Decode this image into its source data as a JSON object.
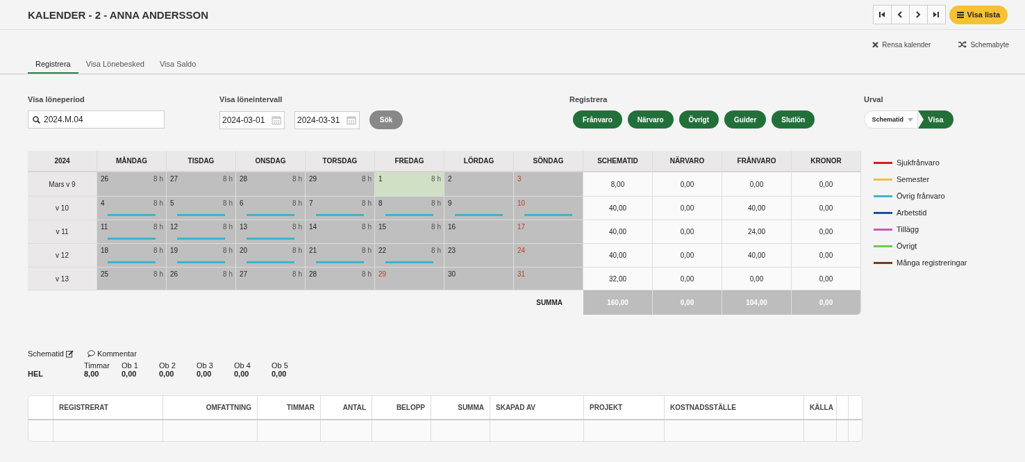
{
  "header": {
    "title": "KALENDER - 2 - ANNA ANDERSSON",
    "list_button": "Visa lista"
  },
  "actions": [
    {
      "kind": "clear",
      "label": "Rensa kalender"
    },
    {
      "kind": "shuffle",
      "label": "Schemabyte"
    }
  ],
  "tabs": [
    {
      "label": "Registrera",
      "selected": true
    },
    {
      "label": "Visa Lönebesked",
      "selected": false
    },
    {
      "label": "Visa Saldo",
      "selected": false
    }
  ],
  "filters": {
    "period_label": "Visa löneperiod",
    "period_value": "2024.M.04",
    "interval_label": "Visa löneintervall",
    "from": "2024-03-01",
    "to": "2024-03-31",
    "search_button": "Sök",
    "register_label": "Registrera",
    "register_buttons": [
      "Frånvaro",
      "Närvaro",
      "Övrigt",
      "Guider",
      "Slutlön"
    ],
    "selection_label": "Urval",
    "selection_value": "Schematid",
    "show_button": "Visa"
  },
  "calendar": {
    "year": "2024",
    "day_columns": [
      "MÅNDAG",
      "TISDAG",
      "ONSDAG",
      "TORSDAG",
      "FREDAG",
      "LÖRDAG",
      "SÖNDAG"
    ],
    "sum_columns": [
      "SCHEMATID",
      "NÄRVARO",
      "FRÅNVARO",
      "KRONOR"
    ],
    "weeks": [
      {
        "label": "Mars v 9",
        "sums": [
          "8,00",
          "0,00",
          "0,00",
          "0,00"
        ],
        "days": [
          {
            "day": "26",
            "hours": "8 h",
            "holiday": false,
            "selected": false
          },
          {
            "day": "27",
            "hours": "8 h",
            "holiday": false,
            "selected": false
          },
          {
            "day": "28",
            "hours": "8 h",
            "holiday": false,
            "selected": false
          },
          {
            "day": "29",
            "hours": "8 h",
            "holiday": false,
            "selected": false
          },
          {
            "day": "1",
            "hours": "8 h",
            "holiday": false,
            "selected": true
          },
          {
            "day": "2",
            "holiday": false,
            "selected": false
          },
          {
            "day": "3",
            "holiday": true,
            "selected": false
          }
        ]
      },
      {
        "label": "v 10",
        "sums": [
          "40,00",
          "0,00",
          "40,00",
          "0,00"
        ],
        "days": [
          {
            "day": "4",
            "hours": "8 h",
            "holiday": false,
            "selected": false,
            "color": "#3ab5cc"
          },
          {
            "day": "5",
            "hours": "8 h",
            "holiday": false,
            "selected": false,
            "color": "#3ab5cc"
          },
          {
            "day": "6",
            "hours": "8 h",
            "holiday": false,
            "selected": false,
            "color": "#3ab5cc"
          },
          {
            "day": "7",
            "hours": "8 h",
            "holiday": false,
            "selected": false,
            "color": "#3ab5cc"
          },
          {
            "day": "8",
            "hours": "8 h",
            "holiday": false,
            "selected": false,
            "color": "#3ab5cc"
          },
          {
            "day": "9",
            "holiday": false,
            "selected": false,
            "color": "#3ab5cc"
          },
          {
            "day": "10",
            "holiday": true,
            "selected": false,
            "color": "#3ab5cc"
          }
        ]
      },
      {
        "label": "v 11",
        "sums": [
          "40,00",
          "0,00",
          "24,00",
          "0,00"
        ],
        "days": [
          {
            "day": "11",
            "hours": "8 h",
            "holiday": false,
            "selected": false,
            "color": "#3ab5cc"
          },
          {
            "day": "12",
            "hours": "8 h",
            "holiday": false,
            "selected": false,
            "color": "#3ab5cc"
          },
          {
            "day": "13",
            "hours": "8 h",
            "holiday": false,
            "selected": false,
            "color": "#3ab5cc"
          },
          {
            "day": "14",
            "hours": "8 h",
            "holiday": false,
            "selected": false
          },
          {
            "day": "15",
            "hours": "8 h",
            "holiday": false,
            "selected": false
          },
          {
            "day": "16",
            "holiday": false,
            "selected": false
          },
          {
            "day": "17",
            "holiday": true,
            "selected": false
          }
        ]
      },
      {
        "label": "v 12",
        "sums": [
          "40,00",
          "0,00",
          "40,00",
          "0,00"
        ],
        "days": [
          {
            "day": "18",
            "hours": "8 h",
            "holiday": false,
            "selected": false,
            "color": "#3ab5cc"
          },
          {
            "day": "19",
            "hours": "8 h",
            "holiday": false,
            "selected": false,
            "color": "#3ab5cc"
          },
          {
            "day": "20",
            "hours": "8 h",
            "holiday": false,
            "selected": false,
            "color": "#3ab5cc"
          },
          {
            "day": "21",
            "hours": "8 h",
            "holiday": false,
            "selected": false,
            "color": "#3ab5cc"
          },
          {
            "day": "22",
            "hours": "8 h",
            "holiday": false,
            "selected": false,
            "color": "#3ab5cc"
          },
          {
            "day": "23",
            "holiday": false,
            "selected": false
          },
          {
            "day": "24",
            "holiday": true,
            "selected": false
          }
        ]
      },
      {
        "label": "v 13",
        "sums": [
          "32,00",
          "0,00",
          "0,00",
          "0,00"
        ],
        "days": [
          {
            "day": "25",
            "hours": "8 h",
            "holiday": false,
            "selected": false
          },
          {
            "day": "26",
            "hours": "8 h",
            "holiday": false,
            "selected": false
          },
          {
            "day": "27",
            "hours": "8 h",
            "holiday": false,
            "selected": false
          },
          {
            "day": "28",
            "hours": "8 h",
            "holiday": false,
            "selected": false
          },
          {
            "day": "29",
            "holiday": true,
            "selected": false
          },
          {
            "day": "30",
            "holiday": false,
            "selected": false
          },
          {
            "day": "31",
            "holiday": true,
            "selected": false
          }
        ]
      }
    ],
    "total_label": "SUMMA",
    "totals": [
      "160,00",
      "0,00",
      "104,00",
      "0,00"
    ]
  },
  "legend": [
    {
      "label": "Sjukfrånvaro",
      "color": "#d0201c"
    },
    {
      "label": "Semester",
      "color": "#f0c040"
    },
    {
      "label": "Övrig frånvaro",
      "color": "#3ab5cc"
    },
    {
      "label": "Arbetstid",
      "color": "#1e4fa0"
    },
    {
      "label": "Tillägg",
      "color": "#c85bb8"
    },
    {
      "label": "Övrigt",
      "color": "#6ccb4a"
    },
    {
      "label": "Många registreringar",
      "color": "#7a3a1a"
    }
  ],
  "schedule": {
    "link": "Schematid",
    "comment": "Kommentar",
    "type": "HEL",
    "stats": [
      {
        "label": "Timmar",
        "value": "8,00"
      },
      {
        "label": "Ob 1",
        "value": "0,00"
      },
      {
        "label": "Ob 2",
        "value": "0,00"
      },
      {
        "label": "Ob 3",
        "value": "0,00"
      },
      {
        "label": "Ob 4",
        "value": "0,00"
      },
      {
        "label": "Ob 5",
        "value": "0,00"
      }
    ]
  },
  "registrations": {
    "columns": [
      "",
      "REGISTRERAT",
      "OMFATTNING",
      "TIMMAR",
      "ANTAL",
      "BELOPP",
      "SUMMA",
      "SKAPAD AV",
      "PROJEKT",
      "KOSTNADSSTÄLLE",
      "KÄLLA",
      "",
      ""
    ]
  }
}
